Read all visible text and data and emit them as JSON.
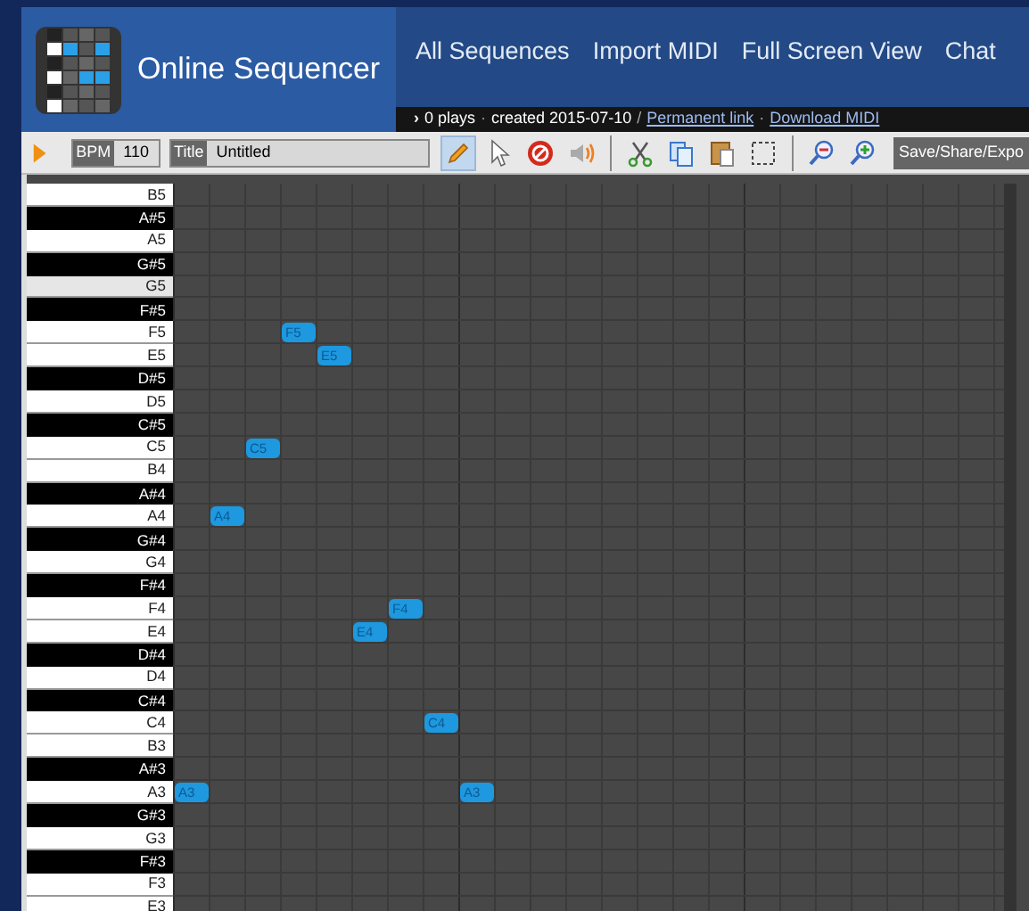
{
  "header": {
    "site_name": "Online Sequencer",
    "nav": [
      "All Sequences",
      "Import MIDI",
      "Full Screen View",
      "Chat"
    ],
    "info": [
      {
        "kind": "chevron",
        "text": "›"
      },
      {
        "kind": "text",
        "text": "0 plays"
      },
      {
        "kind": "separator",
        "text": "·"
      },
      {
        "kind": "text",
        "text": "created 2015-07-10"
      },
      {
        "kind": "separator",
        "text": "/"
      },
      {
        "kind": "link",
        "text": "Permanent link"
      },
      {
        "kind": "separator",
        "text": "·"
      },
      {
        "kind": "link",
        "text": "Download MIDI"
      }
    ]
  },
  "toolbar": {
    "bpm_label": "BPM",
    "bpm": "110",
    "title_label": "Title",
    "title": "Untitled",
    "tool_groups": [
      [
        {
          "kind": "pencil",
          "selected": true
        },
        {
          "kind": "pointer",
          "selected": false
        },
        {
          "kind": "delete",
          "selected": false
        },
        {
          "kind": "speaker",
          "selected": false
        }
      ],
      [
        {
          "kind": "cut",
          "selected": false
        },
        {
          "kind": "copy",
          "selected": false
        },
        {
          "kind": "paste",
          "selected": false
        },
        {
          "kind": "select",
          "selected": false
        }
      ],
      [
        {
          "kind": "zoom-out",
          "selected": false
        },
        {
          "kind": "zoom-in",
          "selected": false
        }
      ]
    ],
    "save_button": "Save/Share/Expo"
  },
  "keys": [
    {
      "label": "B5",
      "kind": "white",
      "highlighted": false
    },
    {
      "label": "A#5",
      "kind": "black",
      "highlighted": false
    },
    {
      "label": "A5",
      "kind": "white",
      "highlighted": false
    },
    {
      "label": "G#5",
      "kind": "black",
      "highlighted": false
    },
    {
      "label": "G5",
      "kind": "white",
      "highlighted": true
    },
    {
      "label": "F#5",
      "kind": "black",
      "highlighted": false
    },
    {
      "label": "F5",
      "kind": "white",
      "highlighted": false,
      "notes": [
        {
          "label": "F5",
          "level": 0.127
        }
      ]
    },
    {
      "label": "E5",
      "kind": "white",
      "highlighted": false,
      "notes": [
        {
          "label": "E5",
          "level": 0.169
        }
      ]
    },
    {
      "label": "D#5",
      "kind": "black",
      "highlighted": false
    },
    {
      "label": "D5",
      "kind": "white",
      "highlighted": false
    },
    {
      "label": "C#5",
      "kind": "black",
      "highlighted": false
    },
    {
      "label": "C5",
      "kind": "white",
      "highlighted": false,
      "notes": [
        {
          "label": "C5",
          "level": 0.085
        }
      ]
    },
    {
      "label": "B4",
      "kind": "white",
      "highlighted": false
    },
    {
      "label": "A#4",
      "kind": "black",
      "highlighted": false
    },
    {
      "label": "A4",
      "kind": "white",
      "highlighted": false,
      "notes": [
        {
          "label": "A4",
          "level": 0.042
        }
      ]
    },
    {
      "label": "G#4",
      "kind": "black",
      "highlighted": false
    },
    {
      "label": "G4",
      "kind": "white",
      "highlighted": false
    },
    {
      "label": "F#4",
      "kind": "black",
      "highlighted": false
    },
    {
      "label": "F4",
      "kind": "white",
      "highlighted": false,
      "notes": [
        {
          "label": "F4",
          "level": 0.254
        }
      ]
    },
    {
      "label": "E4",
      "kind": "white",
      "highlighted": false,
      "notes": [
        {
          "label": "E4",
          "level": 0.211
        }
      ]
    },
    {
      "label": "D#4",
      "kind": "black",
      "highlighted": false
    },
    {
      "label": "D4",
      "kind": "white",
      "highlighted": false
    },
    {
      "label": "C#4",
      "kind": "black",
      "highlighted": false
    },
    {
      "label": "C4",
      "kind": "white",
      "highlighted": false,
      "notes": [
        {
          "label": "C4",
          "level": 0.296
        }
      ]
    },
    {
      "label": "B3",
      "kind": "white",
      "highlighted": false
    },
    {
      "label": "A#3",
      "kind": "black",
      "highlighted": false
    },
    {
      "label": "A3",
      "kind": "white",
      "highlighted": false,
      "notes": [
        {
          "label": "A3",
          "level": 0
        },
        {
          "label": "A3",
          "level": 0.338
        }
      ]
    },
    {
      "label": "G#3",
      "kind": "black",
      "highlighted": false
    },
    {
      "label": "G3",
      "kind": "white",
      "highlighted": false
    },
    {
      "label": "F#3",
      "kind": "black",
      "highlighted": false
    },
    {
      "label": "F3",
      "kind": "white",
      "highlighted": false
    },
    {
      "label": "E3",
      "kind": "white",
      "highlighted": false
    }
  ]
}
